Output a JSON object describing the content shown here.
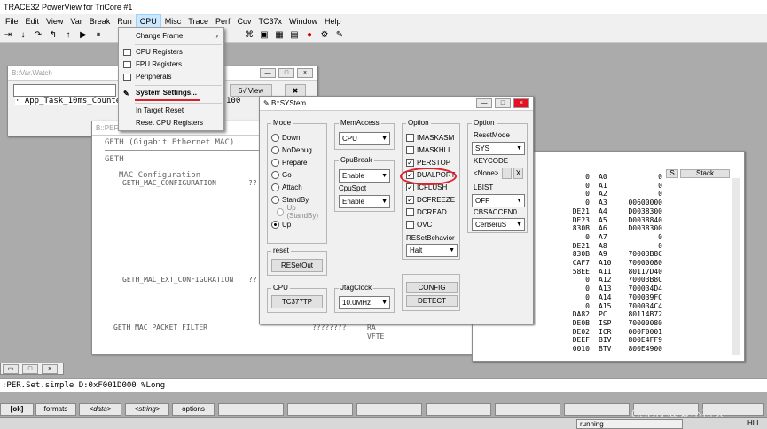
{
  "app_title": "TRACE32 PowerView for TriCore #1",
  "menubar": [
    "File",
    "Edit",
    "View",
    "Var",
    "Break",
    "Run",
    "CPU",
    "Misc",
    "Trace",
    "Perf",
    "Cov",
    "TC37x",
    "Window",
    "Help"
  ],
  "cpu_menu": {
    "change_frame": "Change Frame",
    "cpu_registers": "CPU Registers",
    "fpu_registers": "FPU Registers",
    "peripherals": "Peripherals",
    "system_settings": "System Settings...",
    "in_target_reset": "In Target Reset",
    "reset_cpu_registers": "Reset CPU Registers"
  },
  "watch_window": {
    "title": "B::Var.Watch",
    "view_label": "View",
    "row": "· App_Task_10ms_Counter",
    "value": "100"
  },
  "per_window": {
    "title": "B::PER",
    "geth": "GETH (Gigabit Ethernet MAC)",
    "geth_sub": "GETH",
    "mac_cfg": "MAC Configuration",
    "reg1": "GETH_MAC_CONFIGURATION",
    "reg1_val": "??",
    "reg2": "GETH_MAC_EXT_CONFIGURATION",
    "reg2_val": "??",
    "reg3": "GETH_MAC_PACKET_FILTER",
    "reg3_val": "????????",
    "ra": "RA",
    "vfte": "VFTE"
  },
  "register_window": {
    "stack_label": "Stack",
    "s_label": "S",
    "rows": [
      {
        "l": "0",
        "n": "A0",
        "v": "0"
      },
      {
        "l": "0",
        "n": "A1",
        "v": "0"
      },
      {
        "l": "0",
        "n": "A2",
        "v": "0"
      },
      {
        "l": "0",
        "n": "A3",
        "v": "00600000"
      },
      {
        "l": "DE21",
        "n": "A4",
        "v": "D0038300"
      },
      {
        "l": "DE23",
        "n": "A5",
        "v": "D0038840"
      },
      {
        "l": "830B",
        "n": "A6",
        "v": "D0038300"
      },
      {
        "l": "0",
        "n": "A7",
        "v": "0"
      },
      {
        "l": "DE21",
        "n": "A8",
        "v": "0"
      },
      {
        "l": "830B",
        "n": "A9",
        "v": "70003B8C"
      },
      {
        "l": "CAF7",
        "n": "A10",
        "v": "70000080"
      },
      {
        "l": "58EE",
        "n": "A11",
        "v": "80117D40"
      },
      {
        "l": "0",
        "n": "A12",
        "v": "70003B8C"
      },
      {
        "l": "0",
        "n": "A13",
        "v": "700034D4"
      },
      {
        "l": "0",
        "n": "A14",
        "v": "700039FC"
      },
      {
        "l": "0",
        "n": "A15",
        "v": "700034C4"
      },
      {
        "l": "DA82",
        "n": "PC",
        "v": "80114B72"
      },
      {
        "l": "DE0B",
        "n": "ISP",
        "v": "70000080"
      },
      {
        "l": "DE02",
        "n": "ICR",
        "v": "000F0001"
      },
      {
        "l": "DEEF",
        "n": "BIV",
        "v": "800E4FF9"
      },
      {
        "l": "0010",
        "n": "BTV",
        "v": "800E4900"
      }
    ]
  },
  "system_dialog": {
    "title": "B::SYStem",
    "mode_label": "Mode",
    "modes": [
      "Down",
      "NoDebug",
      "Prepare",
      "Go",
      "Attach",
      "StandBy",
      "Up (StandBy)",
      "Up"
    ],
    "memaccess_label": "MemAccess",
    "memaccess_value": "CPU",
    "cpubreak_label": "CpuBreak",
    "cpubreak_value": "Enable",
    "cpuspot_label": "CpuSpot",
    "cpuspot_value": "Enable",
    "option_label": "Option",
    "options": [
      {
        "label": "IMASKASM",
        "checked": false
      },
      {
        "label": "IMASKHLL",
        "checked": false
      },
      {
        "label": "PERSTOP",
        "checked": true
      },
      {
        "label": "DUALPORT",
        "checked": true
      },
      {
        "label": "ICFLUSH",
        "checked": true
      },
      {
        "label": "DCFREEZE",
        "checked": true
      },
      {
        "label": "DCREAD",
        "checked": false
      },
      {
        "label": "OVC",
        "checked": false
      }
    ],
    "resetbehavior_label": "RESetBehavior",
    "resetbehavior_value": "Halt",
    "option2_label": "Option",
    "resetmode_label": "ResetMode",
    "resetmode_value": "SYS",
    "keycode_label": "KEYCODE",
    "keycode_value": "<None>",
    "keycode_dot": ".",
    "keycode_x": "X",
    "lbist_label": "LBIST",
    "lbist_value": "OFF",
    "cbsaccen_label": "CBSACCEN0",
    "cbsaccen_value": "CerBeruS",
    "reset_label": "reset",
    "reset_button": "RESetOut",
    "cpu_label": "CPU",
    "cpu_button": "TC377TP",
    "jtag_label": "JtagClock",
    "jtag_value": "10.0MHz",
    "config_button": "CONFIG",
    "detect_button": "DETECT"
  },
  "command_line": ":PER.Set.simple D:0xF001D000 %Long",
  "bottom_buttons": [
    "[ok]",
    "formats",
    "<data>",
    "<string>",
    "options"
  ],
  "status": {
    "running": "running",
    "hll": "HLL"
  },
  "watermark": "CSDN @爱不持久",
  "colors": {
    "annotation_red": "#e0202a",
    "highlight": "#cce8ff",
    "running_bg": "#f0f0f0"
  }
}
